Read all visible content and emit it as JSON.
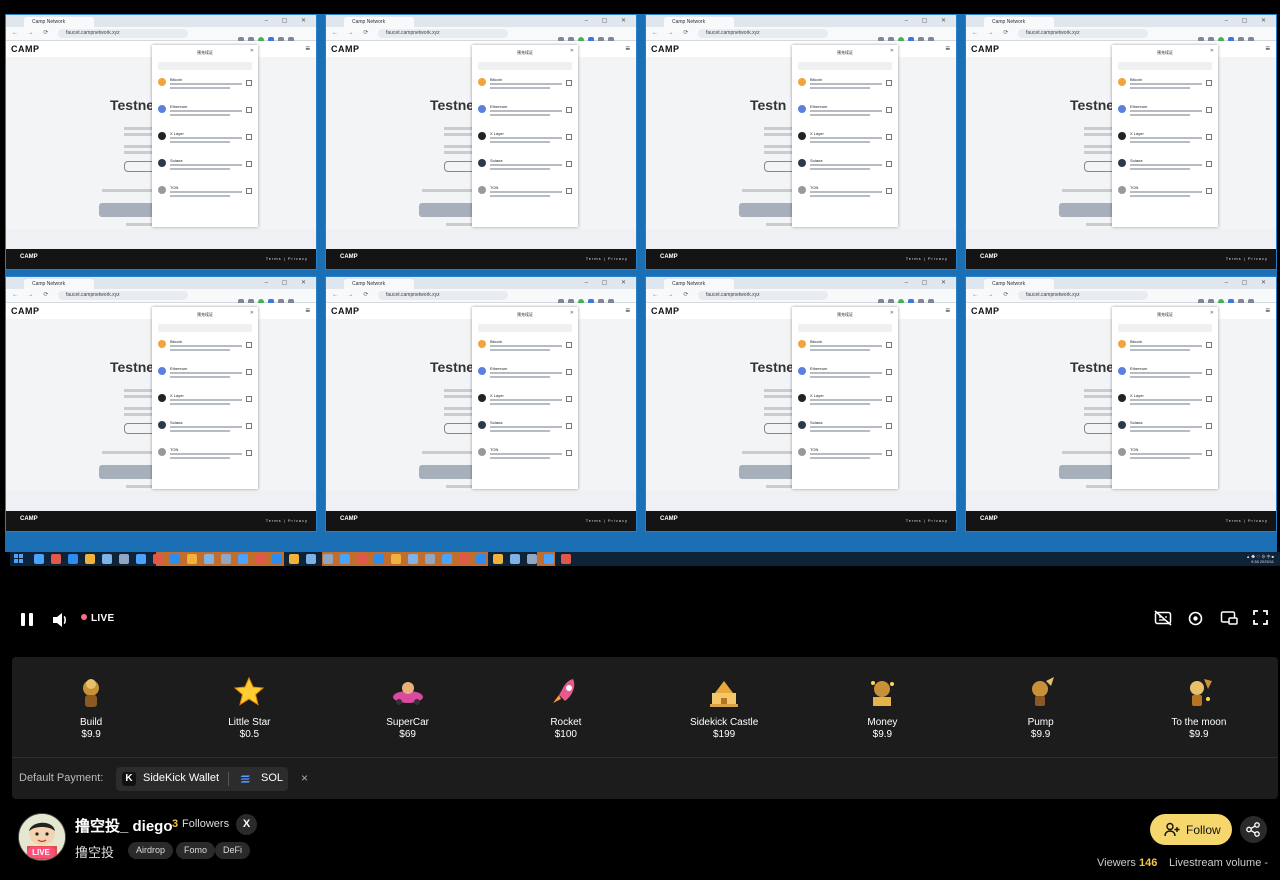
{
  "stream": {
    "live_label": "LIVE",
    "windows": [
      {
        "tab_title": "Camp Network",
        "url": "faucet.campnetwork.xyz",
        "heading": "Testne",
        "logo": "CAMP",
        "popup_title": "预充续证"
      },
      {
        "tab_title": "Camp Network",
        "url": "faucet.campnetwork.xyz",
        "heading": "Testne",
        "logo": "CAMP",
        "popup_title": "预充续证"
      },
      {
        "tab_title": "Camp Network",
        "url": "faucet.campnetwork.xyz",
        "heading": "Testn",
        "logo": "CAMP",
        "popup_title": "预充续证"
      },
      {
        "tab_title": "Camp Network",
        "url": "faucet.campnetwork.xyz",
        "heading": "Testne",
        "logo": "CAMP",
        "popup_title": "预充续证"
      },
      {
        "tab_title": "Camp Network",
        "url": "faucet.campnetwork.xyz",
        "heading": "Testne",
        "logo": "CAMP",
        "popup_title": "预充续证"
      },
      {
        "tab_title": "Camp Network",
        "url": "faucet.campnetwork.xyz",
        "heading": "Testne",
        "logo": "CAMP",
        "popup_title": "预充续证"
      },
      {
        "tab_title": "Camp Network",
        "url": "faucet.campnetwork.xyz",
        "heading": "Testne",
        "logo": "CAMP",
        "popup_title": "预充续证"
      },
      {
        "tab_title": "Camp Network",
        "url": "faucet.campnetwork.xyz",
        "heading": "Testne",
        "logo": "CAMP",
        "popup_title": "预充续证"
      }
    ],
    "popup_chains": [
      "Bitcoin",
      "Ethereum",
      "X Layer",
      "Solana",
      "TON"
    ],
    "footer_logo": "CAMP",
    "footer_links": "Terms | Privacy"
  },
  "gifts": [
    {
      "name": "Build",
      "price": "$9.9",
      "icon": "builder-icon"
    },
    {
      "name": "Little Star",
      "price": "$0.5",
      "icon": "star-icon"
    },
    {
      "name": "SuperCar",
      "price": "$69",
      "icon": "car-icon"
    },
    {
      "name": "Rocket",
      "price": "$100",
      "icon": "rocket-icon"
    },
    {
      "name": "Sidekick Castle",
      "price": "$199",
      "icon": "castle-icon"
    },
    {
      "name": "Money",
      "price": "$9.9",
      "icon": "money-icon"
    },
    {
      "name": "Pump",
      "price": "$9.9",
      "icon": "pump-icon"
    },
    {
      "name": "To the moon",
      "price": "$9.9",
      "icon": "moon-icon"
    }
  ],
  "payment": {
    "label": "Default Payment:",
    "wallet": "SideKick Wallet",
    "currency": "SOL",
    "close": "×"
  },
  "streamer": {
    "name": "撸空投_ diego",
    "followers_count": "3",
    "followers_label": "Followers",
    "x_label": "X",
    "subtitle": "撸空投",
    "tags": [
      "Airdrop",
      "Fomo",
      "DeFi"
    ],
    "live_badge": "LIVE"
  },
  "actions": {
    "follow": "Follow",
    "viewers_label": "Viewers",
    "viewers_count": "146",
    "volume_label": "Livestream volume"
  },
  "colors": {
    "accent_yellow": "#f5d76e",
    "live_pink": "#ff4f7b",
    "count_gold": "#f5c542",
    "panel_bg": "#1c1c1c"
  }
}
